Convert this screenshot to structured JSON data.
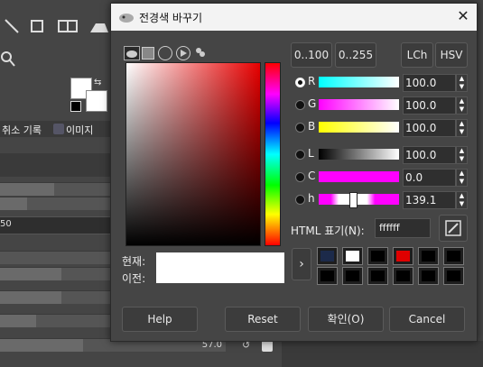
{
  "dialog": {
    "title": "전경색 바꾸기"
  },
  "mode_buttons": {
    "range_100": "0..100",
    "range_255": "0..255",
    "lch": "LCh",
    "hsv": "HSV"
  },
  "channels": [
    {
      "label": "R",
      "value": "100.0",
      "selected": true
    },
    {
      "label": "G",
      "value": "100.0",
      "selected": false
    },
    {
      "label": "B",
      "value": "100.0",
      "selected": false
    },
    {
      "label": "L",
      "value": "100.0",
      "selected": false
    },
    {
      "label": "C",
      "value": "0.0",
      "selected": false
    },
    {
      "label": "h",
      "value": "139.1",
      "selected": false
    }
  ],
  "html_notation": {
    "label": "HTML 표기(N):",
    "value": "ffffff"
  },
  "current": {
    "label": "현재:",
    "color": "#ffffff"
  },
  "previous": {
    "label": "이전:",
    "color": "#ffffff"
  },
  "history_colors": [
    "#1c2a4a",
    "#ffffff",
    "#000000",
    "#e00000",
    "#000000",
    "#000000",
    "#000000",
    "#000000",
    "#000000",
    "#000000",
    "#000000",
    "#000000"
  ],
  "buttons": {
    "help": "Help",
    "reset": "Reset",
    "ok": "확인(O)",
    "cancel": "Cancel"
  },
  "background": {
    "tab_undo": "취소 기록",
    "tab_images": "이미지",
    "field_value": "50",
    "slider_value": "57.0"
  }
}
